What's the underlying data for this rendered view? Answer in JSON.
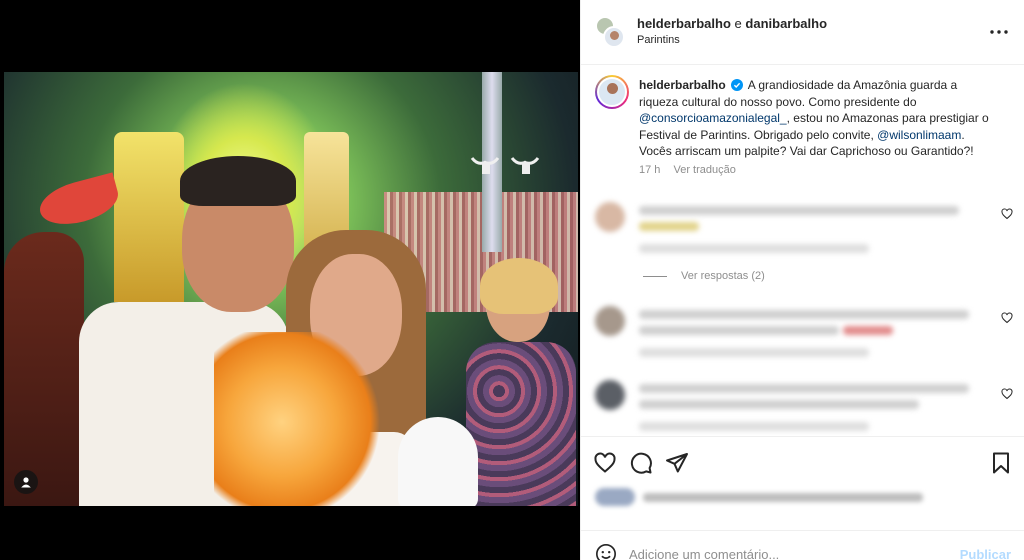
{
  "post": {
    "header": {
      "user_primary": "helderbarbalho",
      "connector": "e",
      "user_secondary": "danibarbalho",
      "location": "Parintins"
    },
    "caption": {
      "username": "helderbarbalho",
      "text_part1": "A grandiosidade da Amazônia guarda a riqueza cultural do nosso povo. Como presidente do",
      "mention1": "@consorcioamazonialegal_",
      "text_part2": ", estou no Amazonas para prestigiar o Festival de Parintins. Obrigado pelo convite,",
      "mention2": "@wilsonlimaam",
      "text_part3": ". Vocês arriscam um palpite? Vai dar Caprichoso ou Garantido?!",
      "time": "17 h",
      "translate": "Ver tradução"
    },
    "comments": {
      "view_replies": "Ver respostas (2)"
    },
    "composer": {
      "placeholder": "Adicione um comentário...",
      "publish_label": "Publicar"
    },
    "colors": {
      "verified": "#0095f6",
      "mention": "#00376b",
      "publish_disabled": "#b3dbff"
    },
    "icons": [
      "more-icon",
      "verified-icon",
      "heart-icon",
      "comment-icon",
      "share-icon",
      "save-icon",
      "emoji-icon",
      "user-tag-icon"
    ]
  }
}
